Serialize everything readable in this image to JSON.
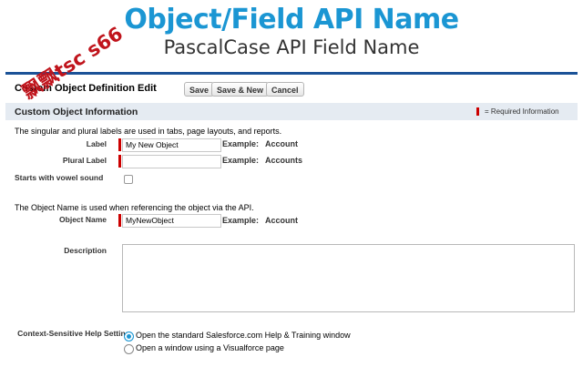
{
  "banner": {
    "title": "Object/Field API Name",
    "subtitle": "PascalCase API Field Name",
    "watermark": "飘飘tsc s66"
  },
  "header": {
    "title": "Custom Object Definition Edit",
    "buttons": {
      "save": "Save",
      "save_new": "Save & New",
      "cancel": "Cancel"
    }
  },
  "section": {
    "title": "Custom Object Information",
    "required_note": "= Required Information"
  },
  "labels_intro": "The singular and plural labels are used in tabs, page layouts, and reports.",
  "fields": {
    "label": {
      "name": "Label",
      "value": "My New Object",
      "example_label": "Example:",
      "example_value": "Account"
    },
    "plural_label": {
      "name": "Plural Label",
      "value": "",
      "example_label": "Example:",
      "example_value": "Accounts"
    },
    "vowel": {
      "name": "Starts with vowel sound",
      "checked": false
    },
    "object_name": {
      "name": "Object Name",
      "value": "MyNewObject",
      "example_label": "Example:",
      "example_value": "Account"
    },
    "description": {
      "name": "Description",
      "value": ""
    },
    "help_setting": {
      "name": "Context-Sensitive Help Setting",
      "options": [
        {
          "label": "Open the standard Salesforce.com Help & Training window",
          "selected": true
        },
        {
          "label": "Open a window using a Visualforce page",
          "selected": false
        }
      ]
    }
  },
  "api_intro": "The Object Name is used when referencing the object via the API.",
  "colors": {
    "accent": "#1b96d3",
    "required": "#cc0000",
    "section_bg": "#e5ebf2",
    "panel_border": "#1b5297"
  }
}
